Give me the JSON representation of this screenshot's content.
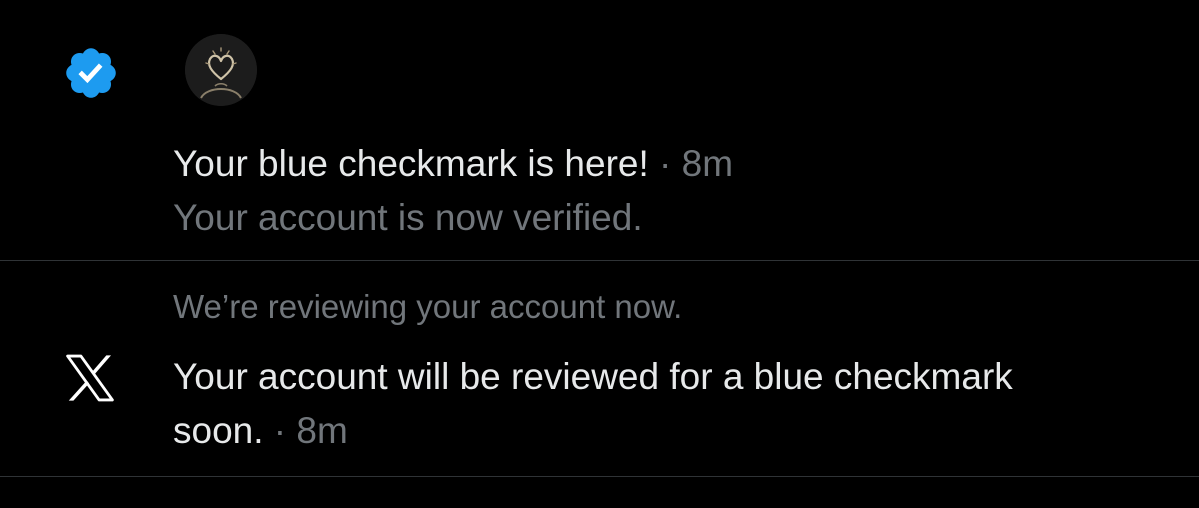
{
  "notifications": [
    {
      "type": "verified",
      "icon": "verified-badge-icon",
      "avatar": "heart-outline-avatar",
      "title": "Your blue checkmark is here!",
      "separator": "·",
      "time": "8m",
      "subtitle": "Your account is now verified."
    },
    {
      "type": "system",
      "icon": "x-logo-icon",
      "preview": "We’re reviewing your account now.",
      "body_line1": "Your account will be reviewed for a blue checkmark",
      "body_line2": "soon.",
      "separator": "·",
      "time": "8m"
    }
  ],
  "colors": {
    "background": "#000000",
    "primary_text": "#e7e9ea",
    "secondary_text": "#71767b",
    "verified_blue": "#1d9bf0",
    "divider": "#2f3336"
  }
}
